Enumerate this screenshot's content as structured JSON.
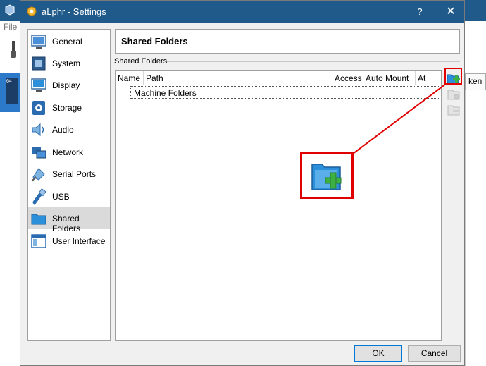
{
  "background": {
    "menu_text": "File",
    "right_tab_label": "ken"
  },
  "dialog": {
    "title": "aLphr - Settings",
    "help_label": "?",
    "close_label": "✕"
  },
  "sidebar": {
    "items": [
      {
        "label": "General",
        "icon": "general-icon"
      },
      {
        "label": "System",
        "icon": "system-icon"
      },
      {
        "label": "Display",
        "icon": "display-icon"
      },
      {
        "label": "Storage",
        "icon": "storage-icon"
      },
      {
        "label": "Audio",
        "icon": "audio-icon"
      },
      {
        "label": "Network",
        "icon": "network-icon"
      },
      {
        "label": "Serial Ports",
        "icon": "serial-ports-icon"
      },
      {
        "label": "USB",
        "icon": "usb-icon"
      },
      {
        "label": "Shared Folders",
        "icon": "shared-folders-icon",
        "selected": true
      },
      {
        "label": "User Interface",
        "icon": "user-interface-icon"
      }
    ]
  },
  "page": {
    "header": "Shared Folders",
    "group_title": "Shared Folders"
  },
  "table": {
    "columns": [
      "Name",
      "Path",
      "Access",
      "Auto Mount",
      "At"
    ],
    "rows": [
      {
        "name": "Machine Folders"
      }
    ]
  },
  "buttons": {
    "ok": "OK",
    "cancel": "Cancel"
  },
  "colors": {
    "titlebar": "#1f5a8a",
    "highlight": "#e00000",
    "folder": "#2b8fd9",
    "plus": "#3cb043"
  }
}
